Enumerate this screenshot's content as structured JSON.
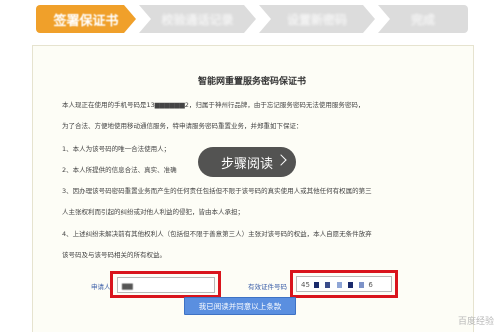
{
  "wizard": {
    "steps": [
      {
        "label": "签署保证书",
        "state": "active"
      },
      {
        "label": "校验通话记录",
        "state": "inactive"
      },
      {
        "label": "设置新密码",
        "state": "inactive"
      },
      {
        "label": "完成",
        "state": "inactive"
      }
    ]
  },
  "colors": {
    "active_step": "#f0a02a",
    "inactive_step": "#dcdcdc",
    "highlight": "#d9141c",
    "button": "#5a8fe0"
  },
  "document": {
    "title": "智能网重置服务密码保证书",
    "paragraphs": [
      "本人现正在使用的手机号码是13▆▆▆▆▆▆2，归属于神州行品牌，由于忘记服务密码无法使用服务密码，",
      "为了合法、方便地使用移动通信服务，特申请服务密码重置业务，并郑重如下保证：",
      "1、本人为该号码的唯一合法使用人；",
      "2、本人所提供的信息合法、真实、准确",
      "3、因办理该号码密码重置业务而产生的任何责任包括但不限于该号码的真实使用人或其他任何有权属的第三",
      "人主张权利而引起的纠纷或对他人利益的侵犯，皆由本人承担；",
      "4、上述纠纷未解决前有其他权利人（包括但不限于善意第三人）主张对该号码的权益，本人自愿无条件放弃",
      "该号码及与该号码相关的所有权益。"
    ]
  },
  "overlay": {
    "label": "步骤阅读"
  },
  "form": {
    "applicant_label": "申请人",
    "applicant_value": "▆▆",
    "id_label": "有效证件号码",
    "id_value_prefix": "45",
    "id_value_suffix": "6"
  },
  "confirm_button": {
    "label": "我已阅读并同意以上条款"
  },
  "watermark": "百度经验"
}
